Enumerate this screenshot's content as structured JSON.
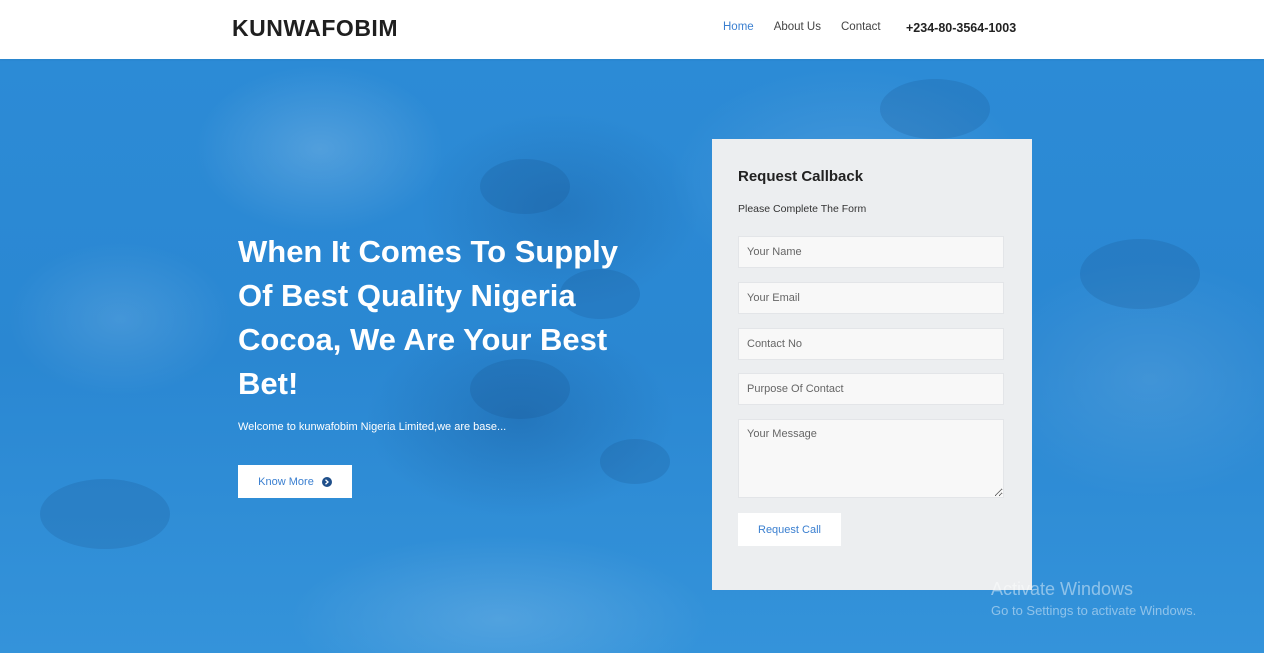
{
  "header": {
    "brand": "KUNWAFOBIM",
    "nav": [
      {
        "label": "Home",
        "active": true
      },
      {
        "label": "About Us",
        "active": false
      },
      {
        "label": "Contact",
        "active": false
      }
    ],
    "phone": "+234-80-3564-1003"
  },
  "hero": {
    "title": "When It Comes To Supply Of Best Quality Nigeria Cocoa, We Are Your Best Bet!",
    "subtitle": "Welcome to kunwafobim Nigeria Limited,we are base...",
    "button_label": "Know More",
    "button_icon": "chevron-right-circle-icon"
  },
  "form": {
    "title": "Request Callback",
    "subtitle": "Please Complete The Form",
    "fields": {
      "name_placeholder": "Your Name",
      "email_placeholder": "Your Email",
      "contact_placeholder": "Contact No",
      "purpose_placeholder": "Purpose Of Contact",
      "message_placeholder": "Your Message"
    },
    "submit_label": "Request Call"
  },
  "watermark": {
    "title": "Activate Windows",
    "subtitle": "Go to Settings to activate Windows."
  },
  "colors": {
    "accent": "#3a7fd0",
    "hero_background": "#2f8fd8",
    "form_background": "#eceef0"
  }
}
